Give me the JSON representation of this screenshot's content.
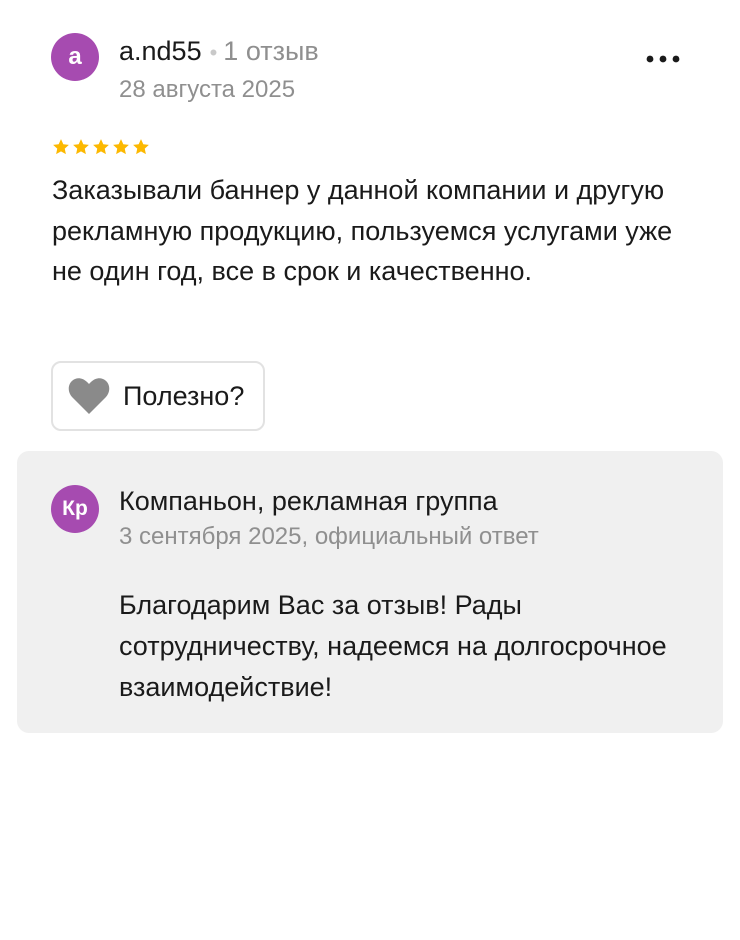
{
  "review": {
    "author": {
      "avatar_letter": "a",
      "name": "a.nd55",
      "separator": "•",
      "review_count": "1 отзыв"
    },
    "date": "28 августа 2025",
    "rating": 5,
    "max_rating": 5,
    "text": "Заказывали баннер у данной компании и другую рекламную продукцию, пользуемся услугами уже не один год, все в срок и качественно.",
    "helpful_label": "Полезно?"
  },
  "reply": {
    "avatar_letters": "Кр",
    "company": "Компаньон, рекламная группа",
    "meta": "3 сентября 2025, официальный ответ",
    "text": "Благодарим Вас за отзыв! Рады сотрудничеству, надеемся на долгосрочное взаимодействие!"
  },
  "colors": {
    "avatar": "#a64bb0",
    "star": "#fcb800",
    "heart": "#8a8a8a",
    "reply_background": "#f0f0f0",
    "muted_text": "#8f8f8f"
  },
  "icons": {
    "more": "more-dots-icon",
    "star": "star-icon",
    "heart": "heart-icon"
  }
}
